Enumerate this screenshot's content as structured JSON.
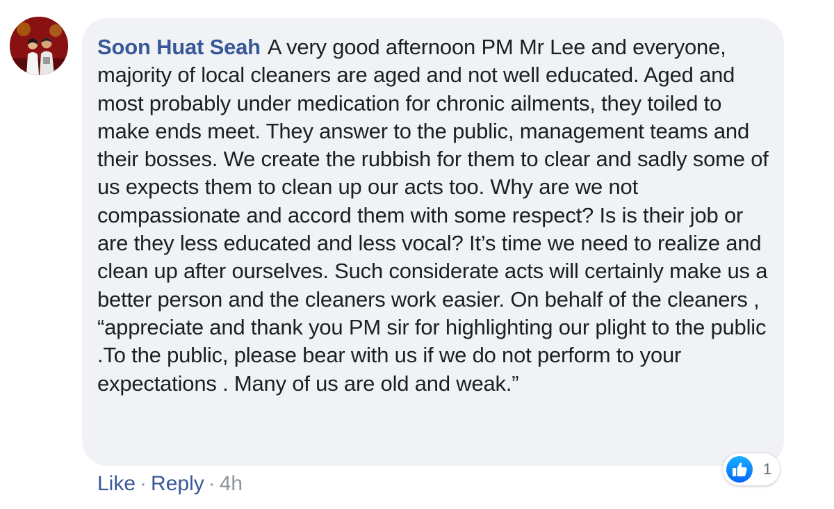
{
  "comment": {
    "author": "Soon Huat Seah",
    "text": "A very good afternoon PM Mr Lee and everyone, majority of local cleaners are aged and not well educated. Aged and most probably under medication for chronic ailments, they toiled to make ends meet. They answer to the public, management teams and their bosses. We create the rubbish for them to clear and sadly some of us expects them to clean up our acts too. Why are we not compassionate and accord them with some respect? Is is their job or are they less educated and less vocal? It’s time we need to realize and clean up after ourselves. Such considerate acts will certainly make us a better person and the cleaners work easier. On behalf of the cleaners , “appreciate and thank you PM sir for highlighting our plight to the public .To the public, please bear with us if we do not perform to your expectations . Many of us are old and weak.”"
  },
  "actions": {
    "like_label": "Like",
    "separator": "·",
    "reply_label": "Reply",
    "timestamp": "4h"
  },
  "reactions": {
    "icon": "thumbs-up-icon",
    "count": "1"
  },
  "colors": {
    "author_name": "#385898",
    "bubble_bg": "#f0f2f5",
    "like_blue": "#1877f2",
    "meta_gray": "#90949c"
  }
}
